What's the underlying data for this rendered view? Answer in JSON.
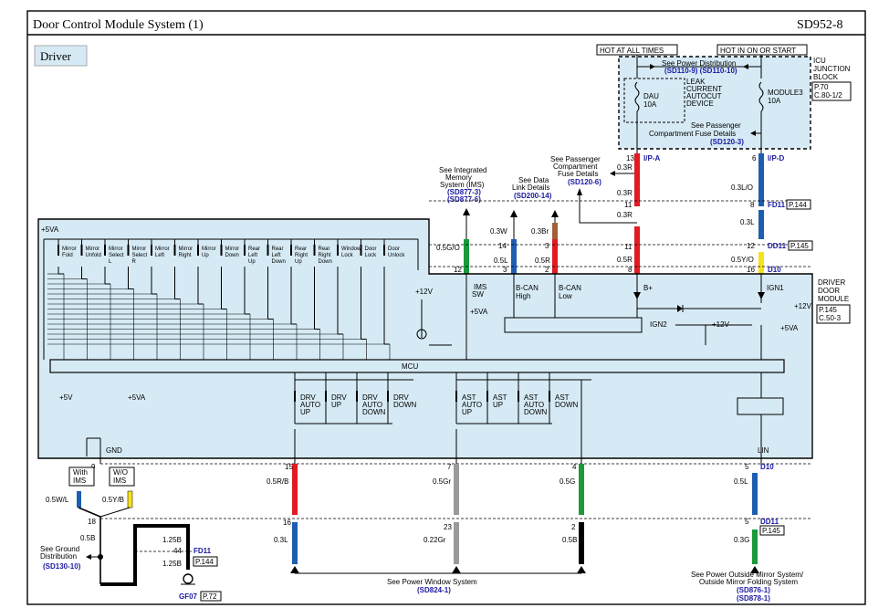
{
  "header": {
    "title": "Door Control Module System (1)",
    "code": "SD952-8"
  },
  "driver_label": "Driver",
  "hot_labels": {
    "left": "HOT AT ALL TIMES",
    "right": "HOT IN ON OR START"
  },
  "junction": {
    "name": [
      "ICU",
      "JUNCTION",
      "BLOCK"
    ],
    "ref": [
      "P.70",
      "C.80-1/2"
    ],
    "power_dist": "See Power Distribution",
    "power_dist_codes": "(SD110-9) (SD110-10)",
    "leak_device": [
      "LEAK",
      "CURRENT",
      "AUTOCUT",
      "DEVICE"
    ],
    "fuse_left": [
      "DAU",
      "10A"
    ],
    "fuse_right": [
      "MODULE3",
      "10A"
    ],
    "passenger_fuse": [
      "See Passenger",
      "Compartment Fuse Details"
    ],
    "passenger_fuse_code": "(SD120-3)"
  },
  "refs": {
    "ims": [
      "See Integrated",
      "Memory",
      "System (IMS)"
    ],
    "ims_codes": [
      "(SD877-3)",
      "(SD877-6)"
    ],
    "data_link": [
      "See Data",
      "Link Details"
    ],
    "data_link_code": "(SD200-14)",
    "pass_comp": [
      "See Passenger",
      "Compartment",
      "Fuse Details"
    ],
    "pass_comp_code": "(SD120-6)"
  },
  "connectors": {
    "ipa": "I/P-A",
    "ipd": "I/P-D",
    "fd11": "FD11",
    "dd11": "DD11",
    "d10": "D10",
    "fd11_ref": "P.144",
    "dd11_ref": "P.145",
    "dd11_ref2": "P.145",
    "fd11_lower_ref": "P.144",
    "gf07": "GF07",
    "gf07_ref": "P.72"
  },
  "wires": {
    "bplus": {
      "pins": [
        "13",
        "11",
        "11",
        "8"
      ],
      "wires": [
        "0.3R",
        "0.3R",
        "0.3R",
        "0.5R"
      ]
    },
    "ign1": {
      "pins": [
        "6",
        "8",
        "12",
        "16"
      ],
      "wires": [
        "0.3L/O",
        "0.3L",
        "0.5Y/O"
      ]
    },
    "ims": {
      "pin": "12",
      "wire": "0.5G/O"
    },
    "bcanh": {
      "pins": [
        "14",
        "3"
      ],
      "wires": [
        "0.3W",
        "0.5L"
      ]
    },
    "bcanl": {
      "pins": [
        "3",
        "2"
      ],
      "wires": [
        "0.3Br",
        "0.5R"
      ]
    },
    "drv": {
      "pins": [
        "15",
        "16"
      ],
      "wires": [
        "0.5R/B",
        "0.3L"
      ]
    },
    "ast": {
      "pins": [
        "7",
        "23"
      ],
      "wires": [
        "0.5Gr",
        "0.22Gr"
      ]
    },
    "mid": {
      "pins": [
        "4",
        "2"
      ],
      "wires": [
        "0.5G",
        "0.5B"
      ]
    },
    "lin": {
      "pins": [
        "5",
        "5"
      ],
      "wires": [
        "0.5L",
        "0.3G"
      ]
    },
    "gnd": {
      "pins": [
        "9",
        "18",
        "44"
      ],
      "wires": [
        "0.5W/L",
        "0.5Y/B",
        "0.5B",
        "1.25B",
        "1.25B"
      ]
    }
  },
  "module": {
    "name": [
      "DRIVER",
      "DOOR",
      "MODULE"
    ],
    "ref": [
      "P.145",
      "C.50-3"
    ],
    "mcu": "MCU",
    "labels": {
      "ims_sw": [
        "IMS",
        "SW"
      ],
      "bcan_h": [
        "B-CAN",
        "High"
      ],
      "bcan_l": [
        "B-CAN",
        "Low"
      ],
      "bplus": "B+",
      "ign1": "IGN1",
      "ign2": "IGN2",
      "gnd": "GND",
      "lin": "LIN",
      "plus5va": "+5VA",
      "plus12v": "+12V",
      "plus5v": "+5V"
    },
    "switches": [
      [
        "Mirror",
        "Fold"
      ],
      [
        "Mirror",
        "Unfold"
      ],
      [
        "Mirror",
        "Select",
        "L"
      ],
      [
        "Mirror",
        "Select",
        "R"
      ],
      [
        "Mirror",
        "Left"
      ],
      [
        "Mirror",
        "Right"
      ],
      [
        "Mirror",
        "Up"
      ],
      [
        "Mirror",
        "Down"
      ],
      [
        "Rear",
        "Left",
        "Up"
      ],
      [
        "Rear",
        "Left",
        "Down"
      ],
      [
        "Rear",
        "Right",
        "Up"
      ],
      [
        "Rear",
        "Right",
        "Down"
      ],
      [
        "Window",
        "Lock"
      ],
      [
        "Door",
        "Lock"
      ],
      [
        "Door",
        "Unlock"
      ]
    ],
    "drv_switches": [
      [
        "DRV",
        "AUTO",
        "UP"
      ],
      [
        "DRV",
        "UP"
      ],
      [
        "DRV",
        "AUTO",
        "DOWN"
      ],
      [
        "DRV",
        "DOWN"
      ]
    ],
    "ast_switches": [
      [
        "AST",
        "AUTO",
        "UP"
      ],
      [
        "AST",
        "UP"
      ],
      [
        "AST",
        "AUTO",
        "DOWN"
      ],
      [
        "AST",
        "DOWN"
      ]
    ]
  },
  "ims_options": {
    "with": [
      "With",
      "IMS"
    ],
    "without": [
      "W/O",
      "IMS"
    ]
  },
  "ground": {
    "see": [
      "See Ground",
      "Distribution"
    ],
    "code": "(SD130-10)"
  },
  "bottom": {
    "window": "See Power Window System",
    "window_code": "(SD824-1)",
    "mirror": [
      "See Power Outside Mirror System/",
      "Outside Mirror Folding System"
    ],
    "mirror_codes": [
      "(SD876-1)",
      "(SD878-1)"
    ]
  },
  "colors": {
    "panel": "#d6eaf5",
    "red": "#e21a22",
    "blue": "#1e5eb0",
    "green": "#1a9a3a",
    "yellow": "#f5e21a",
    "brown": "#a0603a",
    "gray": "#9a9a9a",
    "black": "#000000",
    "ref_text": "#1a1aa0"
  }
}
